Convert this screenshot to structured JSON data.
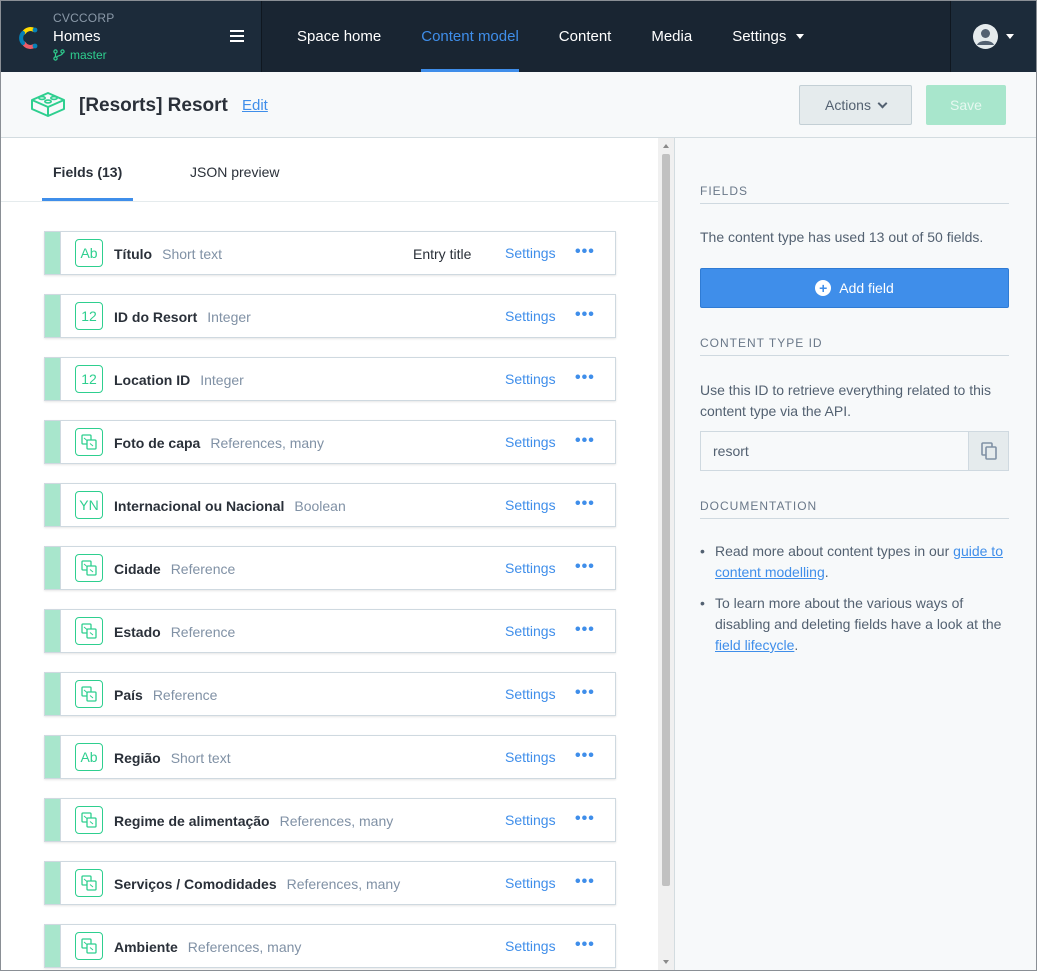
{
  "app": {
    "org": "CVCCORP",
    "space": "Homes",
    "environment": "master"
  },
  "nav": {
    "items": [
      {
        "label": "Space home",
        "active": false
      },
      {
        "label": "Content model",
        "active": true
      },
      {
        "label": "Content",
        "active": false
      },
      {
        "label": "Media",
        "active": false
      },
      {
        "label": "Settings",
        "active": false,
        "has_dropdown": true
      }
    ]
  },
  "header": {
    "title": "[Resorts] Resort",
    "edit_label": "Edit",
    "actions_label": "Actions",
    "save_label": "Save"
  },
  "tabs": [
    {
      "label": "Fields (13)",
      "active": true
    },
    {
      "label": "JSON preview",
      "active": false
    }
  ],
  "fields": [
    {
      "icon": "Ab",
      "icon_name": "short-text-icon",
      "name": "Título",
      "type": "Short text",
      "entry_title": "Entry title",
      "settings": "Settings"
    },
    {
      "icon": "12",
      "icon_name": "integer-icon",
      "name": "ID do Resort",
      "type": "Integer",
      "entry_title": "",
      "settings": "Settings"
    },
    {
      "icon": "12",
      "icon_name": "integer-icon",
      "name": "Location ID",
      "type": "Integer",
      "entry_title": "",
      "settings": "Settings"
    },
    {
      "icon": "",
      "icon_name": "reference-icon",
      "name": "Foto de capa",
      "type": "References, many",
      "entry_title": "",
      "settings": "Settings"
    },
    {
      "icon": "YN",
      "icon_name": "boolean-icon",
      "name": "Internacional ou Nacional",
      "type": "Boolean",
      "entry_title": "",
      "settings": "Settings"
    },
    {
      "icon": "",
      "icon_name": "reference-icon",
      "name": "Cidade",
      "type": "Reference",
      "entry_title": "",
      "settings": "Settings"
    },
    {
      "icon": "",
      "icon_name": "reference-icon",
      "name": "Estado",
      "type": "Reference",
      "entry_title": "",
      "settings": "Settings"
    },
    {
      "icon": "",
      "icon_name": "reference-icon",
      "name": "País",
      "type": "Reference",
      "entry_title": "",
      "settings": "Settings"
    },
    {
      "icon": "Ab",
      "icon_name": "short-text-icon",
      "name": "Região",
      "type": "Short text",
      "entry_title": "",
      "settings": "Settings"
    },
    {
      "icon": "",
      "icon_name": "reference-icon",
      "name": "Regime de alimentação",
      "type": "References, many",
      "entry_title": "",
      "settings": "Settings"
    },
    {
      "icon": "",
      "icon_name": "reference-icon",
      "name": "Serviços / Comodidades",
      "type": "References, many",
      "entry_title": "",
      "settings": "Settings"
    },
    {
      "icon": "",
      "icon_name": "reference-icon",
      "name": "Ambiente",
      "type": "References, many",
      "entry_title": "",
      "settings": "Settings"
    }
  ],
  "sidebar": {
    "fields_title": "FIELDS",
    "fields_text": "The content type has used 13 out of 50 fields.",
    "add_field_label": "Add field",
    "ctid_title": "CONTENT TYPE ID",
    "ctid_text": "Use this ID to retrieve everything related to this content type via the API.",
    "ctid_value": "resort",
    "doc_title": "DOCUMENTATION",
    "doc1_prefix": "Read more about content types in our ",
    "doc1_link": "guide to content modelling",
    "doc1_suffix": ".",
    "doc2_prefix": "To learn more about the various ways of disabling and deleting fields have a look at the ",
    "doc2_link": "field lifecycle",
    "doc2_suffix": "."
  },
  "colors": {
    "nav_bg": "#192532",
    "accent": "#3f8eea",
    "field_green": "#2ecf8f",
    "field_bar": "#a8e6cc"
  }
}
